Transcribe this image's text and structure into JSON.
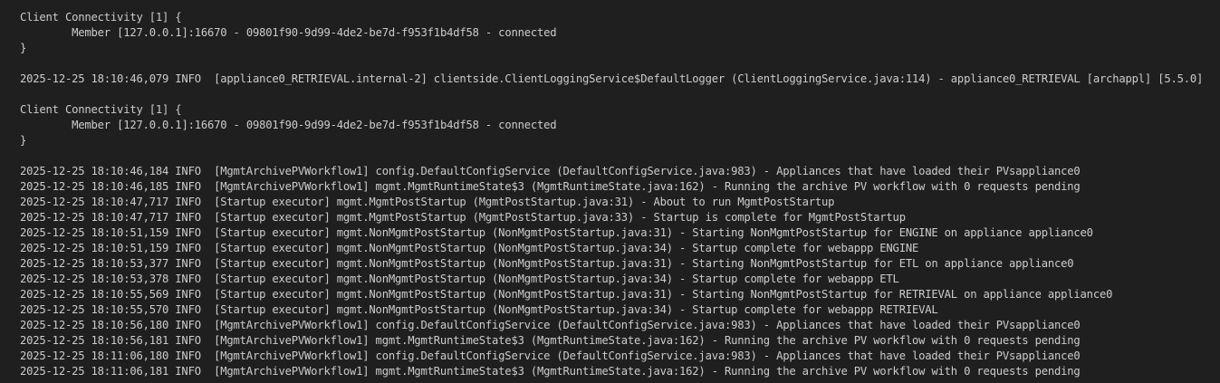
{
  "terminal": {
    "lines": [
      "Client Connectivity [1] {",
      "\tMember [127.0.0.1]:16670 - 09801f90-9d99-4de2-be7d-f953f1b4df58 - connected",
      "}",
      "",
      "2025-12-25 18:10:46,079 INFO  [appliance0_RETRIEVAL.internal-2] clientside.ClientLoggingService$DefaultLogger (ClientLoggingService.java:114) - appliance0_RETRIEVAL [archappl] [5.5.0]",
      "",
      "Client Connectivity [1] {",
      "\tMember [127.0.0.1]:16670 - 09801f90-9d99-4de2-be7d-f953f1b4df58 - connected",
      "}",
      "",
      "2025-12-25 18:10:46,184 INFO  [MgmtArchivePVWorkflow1] config.DefaultConfigService (DefaultConfigService.java:983) - Appliances that have loaded their PVsappliance0",
      "2025-12-25 18:10:46,185 INFO  [MgmtArchivePVWorkflow1] mgmt.MgmtRuntimeState$3 (MgmtRuntimeState.java:162) - Running the archive PV workflow with 0 requests pending",
      "2025-12-25 18:10:47,717 INFO  [Startup executor] mgmt.MgmtPostStartup (MgmtPostStartup.java:31) - About to run MgmtPostStartup",
      "2025-12-25 18:10:47,717 INFO  [Startup executor] mgmt.MgmtPostStartup (MgmtPostStartup.java:33) - Startup is complete for MgmtPostStartup",
      "2025-12-25 18:10:51,159 INFO  [Startup executor] mgmt.NonMgmtPostStartup (NonMgmtPostStartup.java:31) - Starting NonMgmtPostStartup for ENGINE on appliance appliance0",
      "2025-12-25 18:10:51,159 INFO  [Startup executor] mgmt.NonMgmtPostStartup (NonMgmtPostStartup.java:34) - Startup complete for webappp ENGINE",
      "2025-12-25 18:10:53,377 INFO  [Startup executor] mgmt.NonMgmtPostStartup (NonMgmtPostStartup.java:31) - Starting NonMgmtPostStartup for ETL on appliance appliance0",
      "2025-12-25 18:10:53,378 INFO  [Startup executor] mgmt.NonMgmtPostStartup (NonMgmtPostStartup.java:34) - Startup complete for webappp ETL",
      "2025-12-25 18:10:55,569 INFO  [Startup executor] mgmt.NonMgmtPostStartup (NonMgmtPostStartup.java:31) - Starting NonMgmtPostStartup for RETRIEVAL on appliance appliance0",
      "2025-12-25 18:10:55,570 INFO  [Startup executor] mgmt.NonMgmtPostStartup (NonMgmtPostStartup.java:34) - Startup complete for webappp RETRIEVAL",
      "2025-12-25 18:10:56,180 INFO  [MgmtArchivePVWorkflow1] config.DefaultConfigService (DefaultConfigService.java:983) - Appliances that have loaded their PVsappliance0",
      "2025-12-25 18:10:56,181 INFO  [MgmtArchivePVWorkflow1] mgmt.MgmtRuntimeState$3 (MgmtRuntimeState.java:162) - Running the archive PV workflow with 0 requests pending",
      "2025-12-25 18:11:06,180 INFO  [MgmtArchivePVWorkflow1] config.DefaultConfigService (DefaultConfigService.java:983) - Appliances that have loaded their PVsappliance0",
      "2025-12-25 18:11:06,181 INFO  [MgmtArchivePVWorkflow1] mgmt.MgmtRuntimeState$3 (MgmtRuntimeState.java:162) - Running the archive PV workflow with 0 requests pending"
    ]
  }
}
